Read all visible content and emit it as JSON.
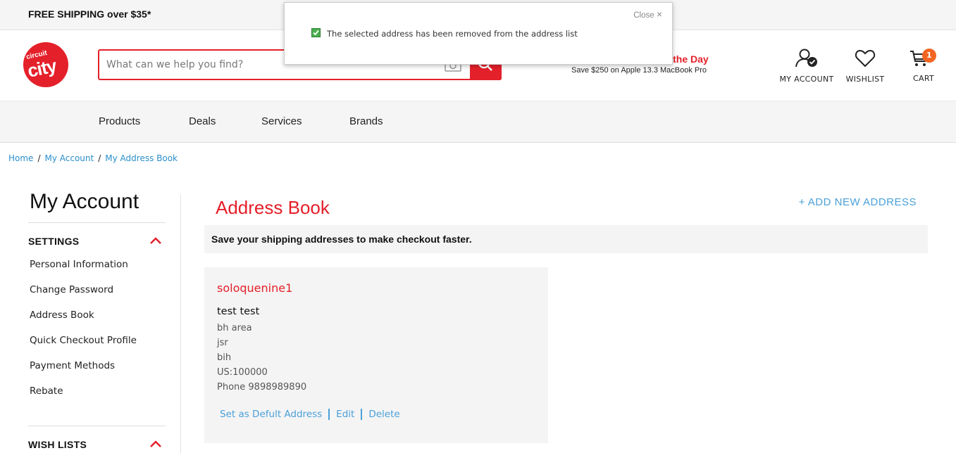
{
  "topbar": {
    "shipping": "FREE SHIPPING over $35*"
  },
  "logo": {
    "line1": "circuit",
    "line2": "city"
  },
  "search": {
    "placeholder": "What can we help you find?"
  },
  "deal": {
    "title_visible": "of the Day",
    "subtitle": "Save $250 on Apple 13.3 MacBook Pro"
  },
  "header": {
    "account_label": "MY ACCOUNT",
    "wishlist_label": "WISHLIST",
    "cart_label": "CART",
    "cart_count": "1"
  },
  "nav": {
    "items": [
      "Products",
      "Deals",
      "Services",
      "Brands"
    ]
  },
  "breadcrumb": [
    "Home",
    "My Account",
    "My Address Book"
  ],
  "sidebar": {
    "title": "My Account",
    "settings_heading": "SETTINGS",
    "links": [
      "Personal Information",
      "Change Password",
      "Address Book",
      "Quick Checkout Profile",
      "Payment Methods",
      "Rebate"
    ],
    "wishlists_heading": "WISH LISTS"
  },
  "main": {
    "title": "Address Book",
    "add_new": "+ ADD NEW ADDRESS",
    "info": "Save your shipping addresses to make checkout faster."
  },
  "address": {
    "nickname": "soloquenine1",
    "name": "test test",
    "lines": [
      "bh area",
      "jsr",
      "bih",
      "US:100000",
      "Phone 9898989890"
    ],
    "set_default": "Set as Defult Address",
    "edit": "Edit",
    "delete": "Delete"
  },
  "toast": {
    "close": "Close",
    "close_x": "×",
    "message": "The selected address has been removed from the address list"
  },
  "colors": {
    "brand_red": "#e4202a",
    "link_blue": "#4ba0d8",
    "badge_orange": "#f26522"
  }
}
